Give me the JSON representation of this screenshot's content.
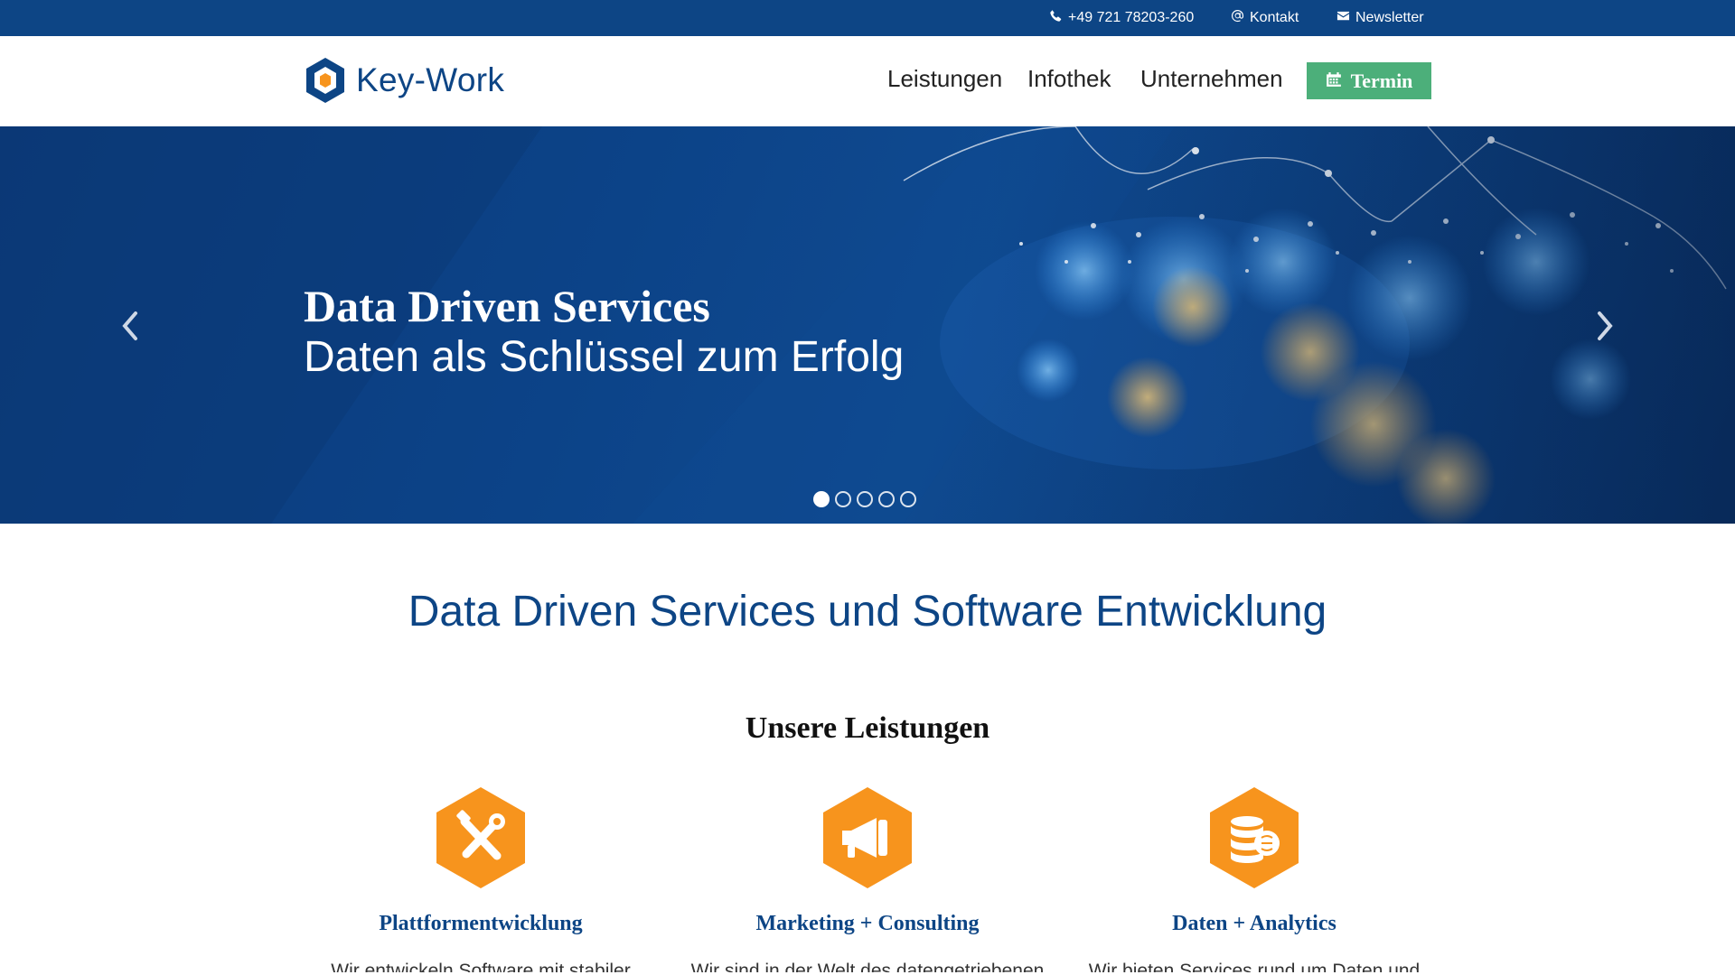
{
  "topbar": {
    "phone": "+49 721 78203-260",
    "contact": "Kontakt",
    "newsletter": "Newsletter"
  },
  "header": {
    "logo_text": "Key-Work",
    "nav": [
      "Leistungen",
      "Infothek",
      "Unternehmen"
    ],
    "cta_label": "Termin"
  },
  "hero": {
    "title": "Data Driven Services",
    "subtitle": "Daten als Schlüssel zum Erfolg",
    "slides_total": 5,
    "active_slide": 1
  },
  "main": {
    "title": "Data Driven Services und Software Entwicklung",
    "section_title": "Unsere Leistungen",
    "services": [
      {
        "title": "Plattformentwicklung",
        "text": "Wir entwickeln Software mit stabiler",
        "icon": "tools-icon"
      },
      {
        "title": "Marketing + Consulting",
        "text": "Wir sind in der Welt des datengetriebenen",
        "icon": "megaphone-icon"
      },
      {
        "title": "Daten + Analytics",
        "text": "Wir bieten Services rund um Daten und",
        "icon": "database-brain-icon"
      }
    ]
  },
  "colors": {
    "brand_blue": "#0d4585",
    "accent_orange": "#f7941d",
    "cta_green": "#4caf7a"
  }
}
